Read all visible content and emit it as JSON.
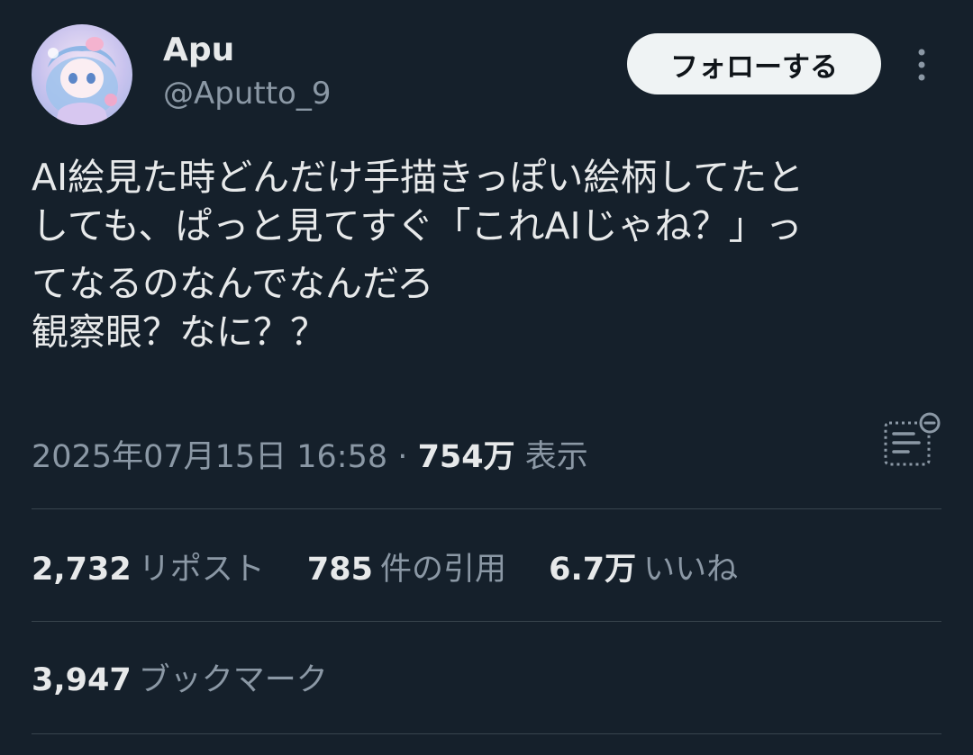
{
  "author": {
    "display_name": "Apu",
    "handle": "@Aputto_9",
    "avatar_icon": "avatar-illustration"
  },
  "follow_button": {
    "label": "フォローする"
  },
  "more_icon": "more-vertical-icon",
  "tweet": {
    "lines": [
      "AI絵見た時どんだけ手描きっぽい絵柄してたと",
      "しても、ぱっと見てすぐ「これAIじゃね？」っ",
      "てなるのなんでなんだろ",
      "観察眼？なに？？"
    ]
  },
  "meta": {
    "datetime": "2025年07月15日 16:58",
    "separator": "·",
    "views": "754万",
    "views_label": "表示"
  },
  "analytics_icon": "analytics-icon",
  "stats": {
    "reposts": "2,732",
    "reposts_label": "リポスト",
    "quotes": "785",
    "quotes_label": "件の引用",
    "likes": "6.7万",
    "likes_label": "いいね",
    "bookmarks": "3,947",
    "bookmarks_label": "ブックマーク"
  },
  "colors": {
    "background": "#15202b",
    "text_primary": "#e7e9ea",
    "text_secondary": "#8b98a5",
    "divider": "#38444d",
    "button_bg": "#eff3f4"
  }
}
